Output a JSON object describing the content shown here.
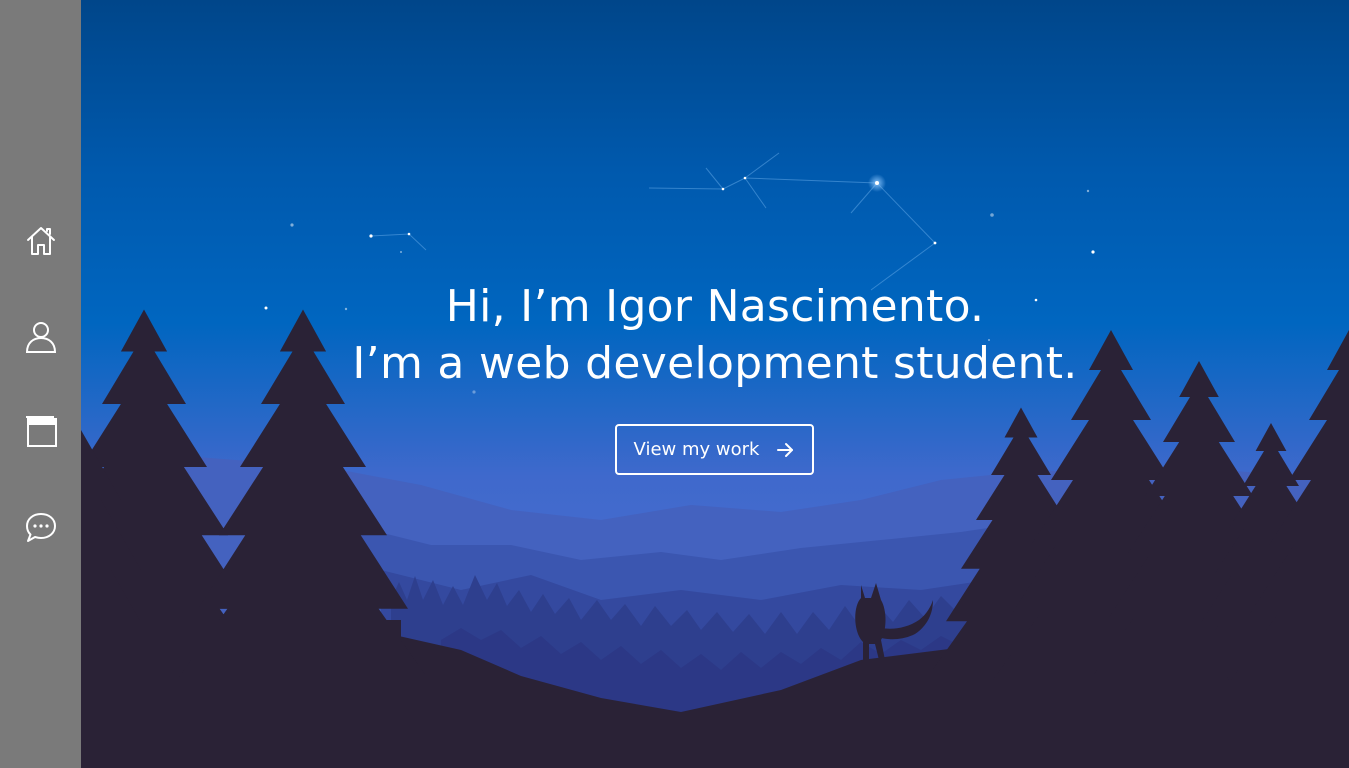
{
  "sidebar": {
    "items": [
      {
        "name": "home",
        "icon": "home-icon"
      },
      {
        "name": "about",
        "icon": "user-icon"
      },
      {
        "name": "portfolio",
        "icon": "window-icon"
      },
      {
        "name": "contact",
        "icon": "chat-icon"
      }
    ]
  },
  "hero": {
    "headline_line1": "Hi, I’m Igor Nascimento.",
    "headline_line2": "I’m a web development student.",
    "cta_label": "View my work",
    "cta_icon": "arrow-right-icon"
  },
  "colors": {
    "sidebar_bg": "#7a7a7a",
    "sky_top": "#00468a",
    "sky_mid": "#0066c0",
    "sky_low": "#4a6ccf",
    "forest_dark": "#2a2236",
    "text": "#ffffff"
  }
}
